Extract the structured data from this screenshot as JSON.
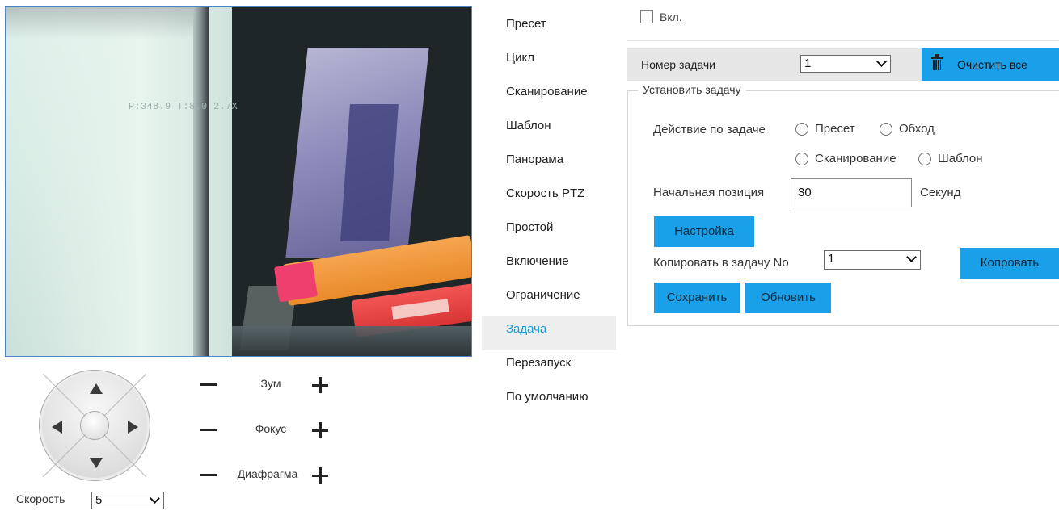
{
  "video": {
    "osd_text": "P:348.9 T:8.0 2.7X"
  },
  "ptz": {
    "zoom_label": "Зум",
    "focus_label": "Фокус",
    "iris_label": "Диафрагма",
    "speed_label": "Скорость",
    "speed_value": "5"
  },
  "menu": {
    "items": [
      {
        "label": "Пресет"
      },
      {
        "label": "Цикл"
      },
      {
        "label": "Сканирование"
      },
      {
        "label": "Шаблон"
      },
      {
        "label": "Панорама"
      },
      {
        "label": "Скорость PTZ"
      },
      {
        "label": "Простой"
      },
      {
        "label": "Включение"
      },
      {
        "label": "Ограничение"
      },
      {
        "label": "Задача"
      },
      {
        "label": "Перезапуск"
      },
      {
        "label": "По умолчанию"
      }
    ],
    "active": "Задача"
  },
  "task": {
    "enable_label": "Вкл.",
    "enable_checked": false,
    "task_number_label": "Номер задачи",
    "task_number_value": "1",
    "clear_all_label": "Очистить все",
    "set_task_legend": "Установить задачу",
    "action_label": "Действие по задаче",
    "actions": [
      "Пресет",
      "Обход",
      "Сканирование",
      "Шаблон"
    ],
    "start_position_label": "Начальная позиция",
    "start_position_value": "30",
    "seconds_label": "Секунд",
    "setup_label": "Настройка",
    "copy_label": "Копировать в задачу No",
    "copy_value": "1",
    "copy_button_label": "Копровать",
    "save_label": "Сохранить",
    "refresh_label": "Обновить"
  },
  "colors": {
    "accent": "#1aa0e8",
    "active_menu_text": "#1a9ad6",
    "active_menu_bg": "#eeeeee",
    "toolbar_bg": "#e6e6e6"
  }
}
